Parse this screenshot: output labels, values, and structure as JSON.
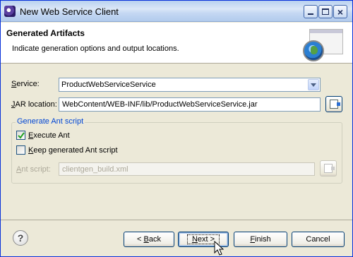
{
  "window": {
    "title": "New Web Service Client"
  },
  "banner": {
    "title": "Generated Artifacts",
    "description": "Indicate generation options and output locations."
  },
  "form": {
    "service_label_prefix": "",
    "service_label_mnemonic": "S",
    "service_label_rest": "ervice:",
    "service_value": "ProductWebServiceService",
    "jar_label_mnemonic": "J",
    "jar_label_rest": "AR location:",
    "jar_value": "WebContent/WEB-INF/lib/ProductWebServiceService.jar",
    "group_title": "Generate Ant script",
    "execute_ant_mnemonic": "E",
    "execute_ant_rest": "xecute Ant",
    "execute_ant_checked": true,
    "keep_script_mnemonic": "K",
    "keep_script_rest": "eep generated Ant script",
    "keep_script_checked": false,
    "ant_script_label_mnemonic": "A",
    "ant_script_label_rest": "nt script:",
    "ant_script_value": "clientgen_build.xml"
  },
  "footer": {
    "help_label": "?",
    "back_prefix": "< ",
    "back_mnemonic": "B",
    "back_rest": "ack",
    "next_mnemonic": "N",
    "next_rest": "ext >",
    "finish_mnemonic": "F",
    "finish_rest": "inish",
    "cancel_label": "Cancel"
  },
  "icons": {
    "title_icon": "eclipse-icon",
    "wizard_banner": "web-service-globe-icon",
    "browse": "browse-icon",
    "help": "help-icon"
  },
  "colors": {
    "group_title": "#0046d5",
    "window_bg": "#ece9d8",
    "button_border": "#003c74"
  }
}
